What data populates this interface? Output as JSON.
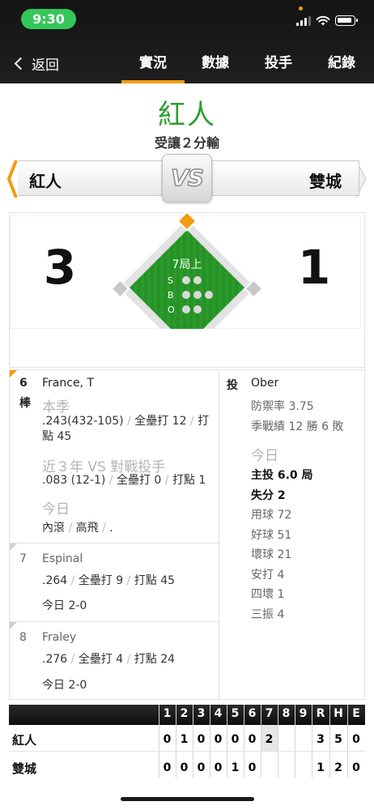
{
  "status_bar": {
    "time": "9:30"
  },
  "nav": {
    "back_label": "返回",
    "tabs": [
      {
        "label": "實況",
        "active": true
      },
      {
        "label": "數據",
        "active": false
      },
      {
        "label": "投手",
        "active": false
      },
      {
        "label": "紀錄",
        "active": false
      }
    ]
  },
  "result": {
    "winner": "紅人",
    "summary": "受讓２分輸"
  },
  "matchup": {
    "away": "紅人",
    "vs": "VS",
    "home": "雙城"
  },
  "score": {
    "away": "3",
    "home": "1",
    "inning": "7局上",
    "count_labels": [
      "S",
      "B",
      "O"
    ],
    "balls_filled": 0,
    "strikes_filled": 0,
    "outs_filled": 0
  },
  "batter": {
    "order": "6",
    "order_suffix": "棒",
    "name": "France, T",
    "season_label": "本季",
    "season_avg": ".243(432-105)",
    "season_hr": "全壘打 12",
    "season_rbi_line1": "打",
    "season_rbi_line2": "點 45",
    "vs_label": "近３年 VS 對戰投手",
    "vs_avg": ".083 (12-1)",
    "vs_hr": "全壘打 0",
    "vs_rbi": "打點 1",
    "today_label": "今日",
    "today_1": "內滾",
    "today_2": "高飛",
    "today_3": "."
  },
  "on_deck": [
    {
      "order": "7",
      "name": "Espinal",
      "avg": ".264",
      "hr": "全壘打 9",
      "rbi": "打點 45",
      "today": "今日 2-0"
    },
    {
      "order": "8",
      "name": "Fraley",
      "avg": ".276",
      "hr": "全壘打 4",
      "rbi": "打點 24",
      "today": "今日 2-0"
    }
  ],
  "pitcher": {
    "tag": "投",
    "name": "Ober",
    "era": "防禦率 3.75",
    "record": "季戰績 12 勝 6 敗",
    "today_label": "今日",
    "ip": "主投 6.0 局",
    "runs": "失分 2",
    "pitches": "用球 72",
    "strikes": "好球 51",
    "balls": "壞球 21",
    "hits": "安打 4",
    "walks": "四壞 1",
    "strikeouts": "三振 4"
  },
  "linescore": {
    "headers": [
      "1",
      "2",
      "3",
      "4",
      "5",
      "6",
      "7",
      "8",
      "9",
      "R",
      "H",
      "E"
    ],
    "rows": [
      {
        "team": "紅人",
        "cells": [
          "0",
          "1",
          "0",
          "0",
          "0",
          "0",
          "2",
          "",
          "",
          "3",
          "5",
          "0"
        ]
      },
      {
        "team": "雙城",
        "cells": [
          "0",
          "0",
          "0",
          "0",
          "1",
          "0",
          "",
          "",
          "",
          "1",
          "2",
          "0"
        ]
      }
    ]
  },
  "colors": {
    "accent": "#f39c12",
    "winner_green": "#2f9d2f",
    "field_green": "#2a9a2a"
  }
}
